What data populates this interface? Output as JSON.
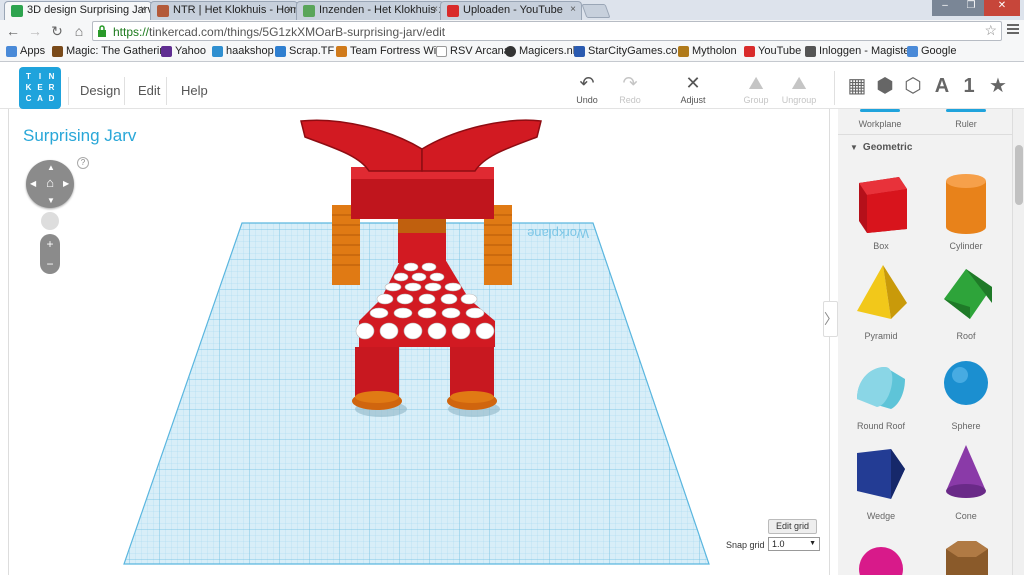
{
  "browser": {
    "tabs": [
      {
        "title": "3D design Surprising Jarv |",
        "icon_color": "#2ea44f",
        "active": true
      },
      {
        "title": "NTR | Het Klokhuis - Hom",
        "icon_color": "#b35a3a",
        "active": false
      },
      {
        "title": "Inzenden - Het Klokhuis z",
        "icon_color": "#5aa55a",
        "active": false
      },
      {
        "title": "Uploaden - YouTube",
        "icon_color": "#d92b2b",
        "active": false
      }
    ],
    "tab_close_glyph": "×",
    "window_controls": [
      "–",
      "❐",
      "✕"
    ],
    "url_scheme": "https://",
    "url_host": "tinkercad.com",
    "url_path": "/things/5G1zkXMOarB-surprising-jarv/edit"
  },
  "bookmarks": [
    {
      "label": "Apps",
      "icon_color": "#4a8ad8"
    },
    {
      "label": "Magic: The Gathering",
      "icon_color": "#7a4a1a"
    },
    {
      "label": "Yahoo",
      "icon_color": "#5f2d91"
    },
    {
      "label": "haakshop",
      "icon_color": "#2f8fd0"
    },
    {
      "label": "Scrap.TF",
      "icon_color": "#2f7fd0"
    },
    {
      "label": "Team Fortress Wiki",
      "icon_color": "#d07a1a"
    },
    {
      "label": "RSV Arcana",
      "icon_color": "#ffffff"
    },
    {
      "label": "Magicers.nl",
      "icon_color": "#333333"
    },
    {
      "label": "StarCityGames.com",
      "icon_color": "#2a5ab0"
    },
    {
      "label": "Mytholon",
      "icon_color": "#b07a1a"
    },
    {
      "label": "YouTube",
      "icon_color": "#d92b2b"
    },
    {
      "label": "Inloggen - Magister",
      "icon_color": "#555555"
    },
    {
      "label": "Google",
      "icon_color": "#4a8ad8"
    }
  ],
  "app": {
    "logo_letters": [
      "TIN",
      "KER",
      "CAD"
    ],
    "menu": [
      "Design",
      "Edit",
      "Help"
    ],
    "tools": {
      "undo": "Undo",
      "redo": "Redo",
      "adjust": "Adjust",
      "group": "Group",
      "ungroup": "Ungroup"
    },
    "view_labels": {
      "text": "A",
      "number": "1"
    }
  },
  "workplane": {
    "design_title": "Surprising Jarv",
    "watermark": "Workplane",
    "help_glyph": "?",
    "zoom_in": "+",
    "zoom_out": "−",
    "edit_grid": "Edit grid",
    "snap_label": "Snap grid",
    "snap_value": "1.0",
    "collapse_glyph": "〉"
  },
  "panel": {
    "helpers": [
      "Workplane",
      "Ruler"
    ],
    "section": "Geometric",
    "shapes": [
      {
        "label": "Box",
        "color": "#d8141c"
      },
      {
        "label": "Cylinder",
        "color": "#e8821a"
      },
      {
        "label": "Pyramid",
        "color": "#f2c81a"
      },
      {
        "label": "Roof",
        "color": "#2ea43a"
      },
      {
        "label": "Round Roof",
        "color": "#5ec4d8"
      },
      {
        "label": "Sphere",
        "color": "#1b8fd0"
      },
      {
        "label": "Wedge",
        "color": "#233c94"
      },
      {
        "label": "Cone",
        "color": "#8a3aa8"
      },
      {
        "label": "",
        "color": "#d81a8a"
      },
      {
        "label": "",
        "color": "#8a5a2a"
      }
    ]
  }
}
